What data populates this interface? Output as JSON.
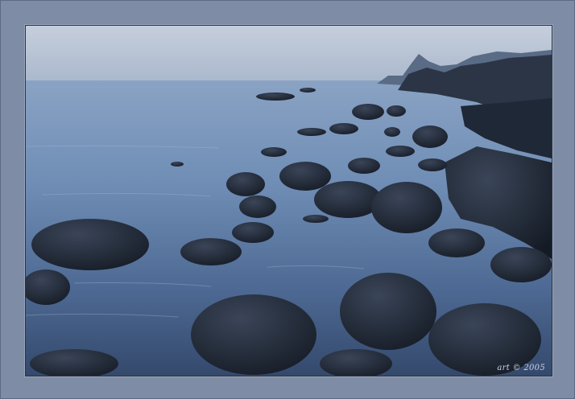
{
  "photo": {
    "subject": "rocky-shoreline-seascape",
    "signature": "art © 2005",
    "colors": {
      "mat": "#7f8ca5",
      "sky_top": "#c5cedc",
      "sky_bottom": "#aab8cc",
      "water_far": "#8aa3c4",
      "water_near": "#3a5680",
      "rock_dark": "#1a222e",
      "rock_mid": "#2c3647"
    }
  }
}
